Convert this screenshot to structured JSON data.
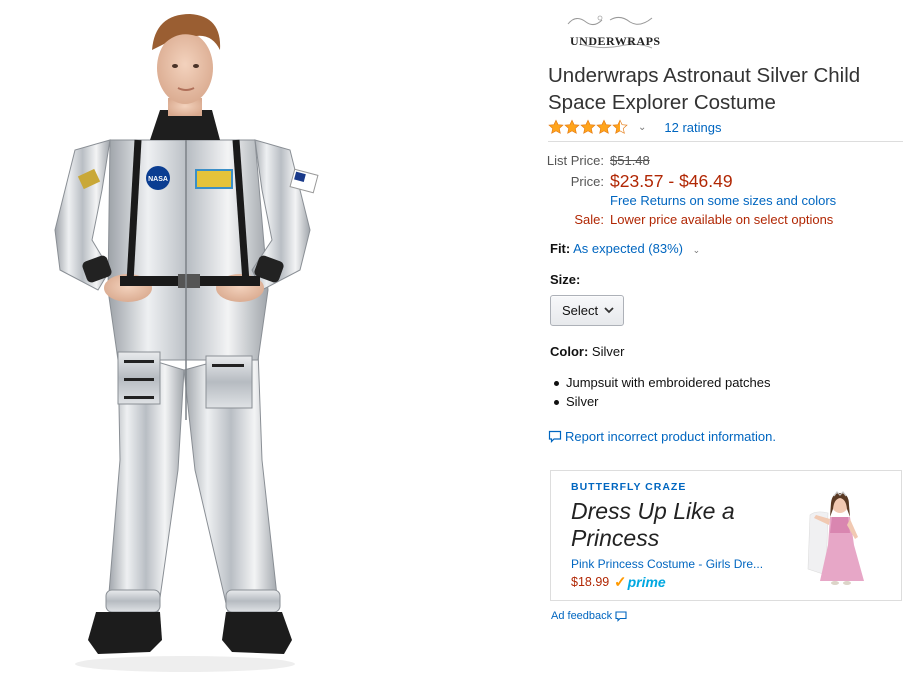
{
  "brand": {
    "logo_text": "UNDERWRAPS"
  },
  "product": {
    "title": "Underwraps Astronaut Silver Child Space Explorer Costume",
    "rating_stars": 4.5,
    "ratings_count": "12 ratings"
  },
  "pricing": {
    "list_label": "List Price:",
    "list_value": "$51.48",
    "price_label": "Price:",
    "price_value": "$23.57 - $46.49",
    "returns_text": "Free Returns on some sizes and colors",
    "sale_label": "Sale:",
    "sale_text": "Lower price available on select options"
  },
  "fit": {
    "label": "Fit:",
    "value": "As expected (83%)"
  },
  "size": {
    "label": "Size:",
    "selected": "Select"
  },
  "color": {
    "label": "Color:",
    "value": "Silver"
  },
  "bullets": [
    "Jumpsuit with embroidered patches",
    "Silver"
  ],
  "report_link": "Report incorrect product information.",
  "ad": {
    "brand": "BUTTERFLY CRAZE",
    "headline": "Dress Up Like a Princess",
    "product_name": "Pink Princess Costume - Girls Dre...",
    "price": "$18.99",
    "prime_label": "prime"
  },
  "ad_feedback": "Ad feedback",
  "colors": {
    "link": "#0066c0",
    "price": "#B12704",
    "star": "#FFA41C",
    "prime": "#00a8e1"
  },
  "icons": {
    "rating_stars": "star-icon",
    "dropdown": "chevron-down-icon",
    "report": "speech-bubble-icon",
    "prime_check": "prime-check-icon"
  }
}
